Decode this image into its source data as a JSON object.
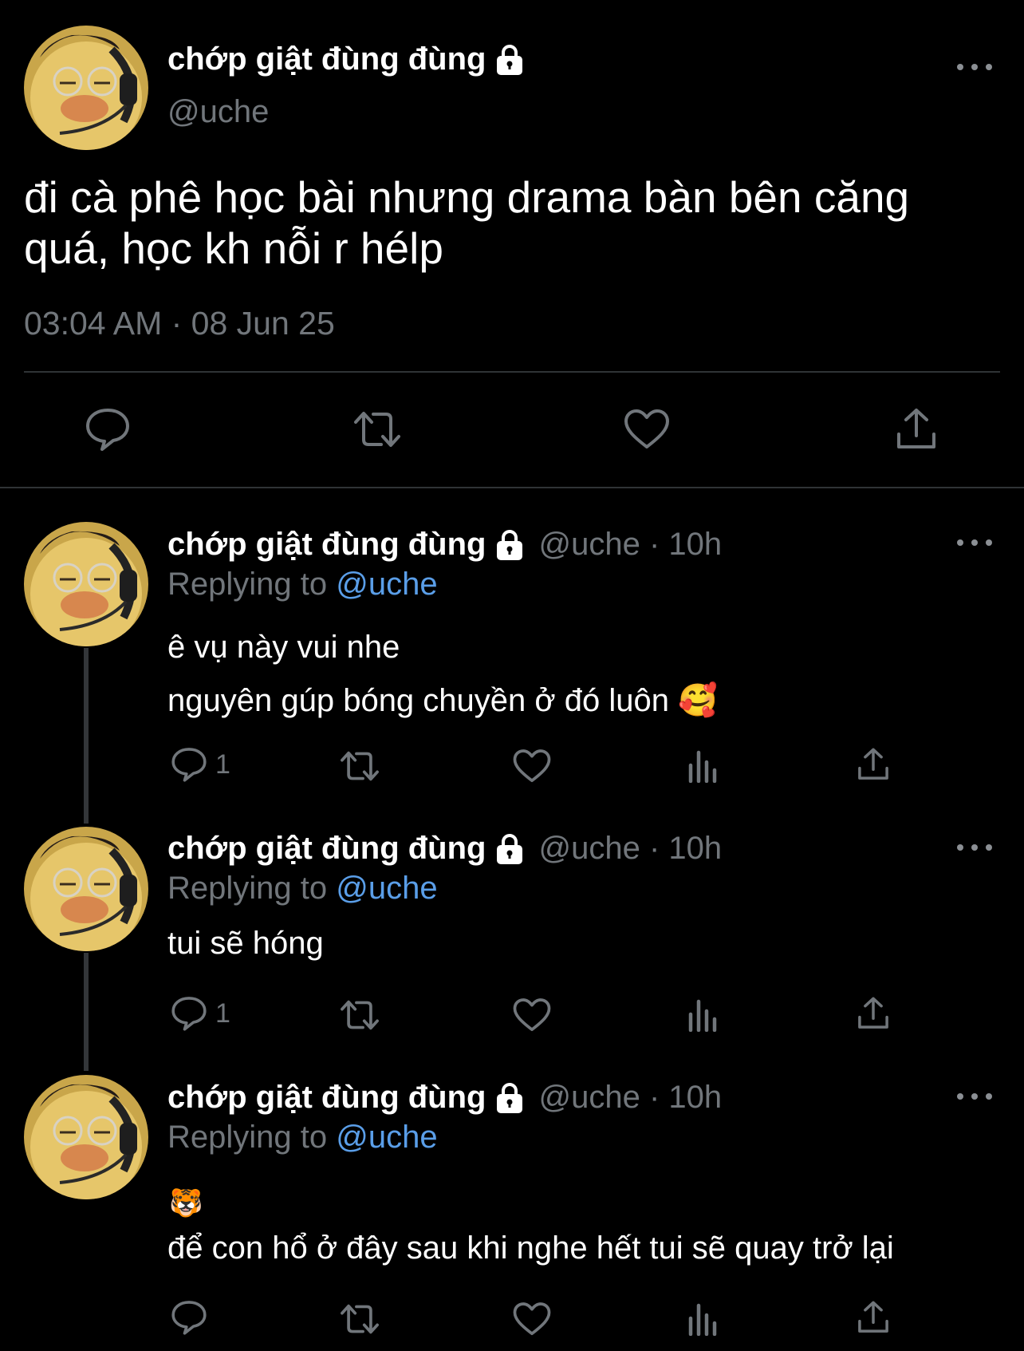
{
  "main_tweet": {
    "display_name": "chớp giật đùng đùng",
    "handle": "@uche",
    "text_line1": "đi cà phê học bài nhưng drama bàn bên căng",
    "text_line2": "quá, học kh nỗi r hélp",
    "timestamp": "03:04 AM · 08 Jun 25",
    "icons": [
      "comment-icon",
      "retweet-icon",
      "heart-icon",
      "share-icon"
    ]
  },
  "replies": [
    {
      "display_name": "chớp giật đùng đùng",
      "handle_time": "@uche · 10h",
      "replying_prefix": "Replying to",
      "replying_to": "@uche",
      "line1": "ê vụ này vui nhe",
      "line2": "nguyên gúp bóng chuyền ở đó luôn",
      "line2_emoji": "🥰",
      "reply_count": "1"
    },
    {
      "display_name": "chớp giật đùng đùng",
      "handle_time": "@uche · 10h",
      "replying_prefix": "Replying to",
      "replying_to": "@uche",
      "line1": "tui sẽ hóng",
      "reply_count": "1"
    },
    {
      "display_name": "chớp giật đùng đùng",
      "handle_time": "@uche · 10h",
      "replying_prefix": "Replying to",
      "replying_to": "@uche",
      "emoji_line": "🐯",
      "line1": "để con hổ ở đây sau khi nghe hết tui sẽ quay trở lại",
      "reply_count": ""
    }
  ],
  "colors": {
    "background": "#000000",
    "text": "#e7e9ea",
    "muted": "#71767b",
    "link": "#5a9ee8",
    "divider": "#2f3336"
  }
}
